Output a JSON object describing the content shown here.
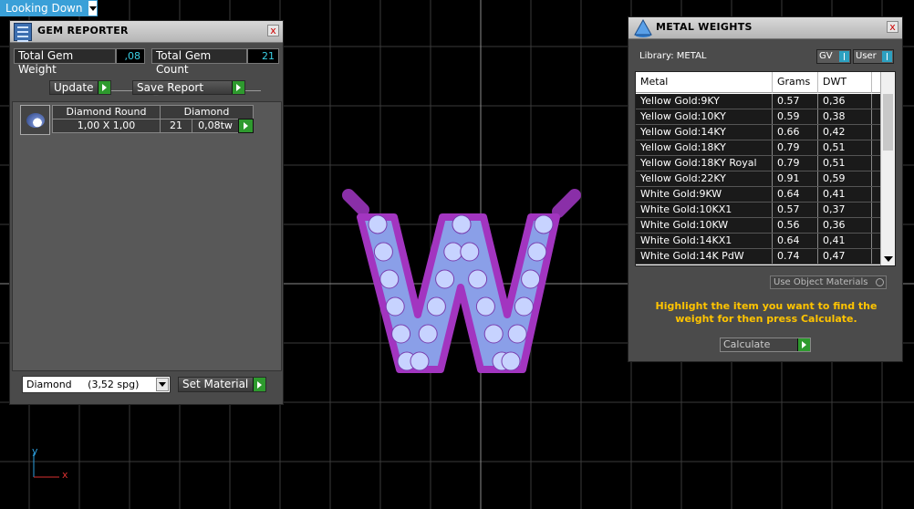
{
  "viewport": {
    "view_label": "Looking Down",
    "grid_color": "#3a3a3a",
    "axis_y": "y",
    "axis_x": "x",
    "model_letter": "W"
  },
  "gem_reporter": {
    "title": "GEM REPORTER",
    "close": "x",
    "total_weight_label": "Total Gem Weight",
    "total_weight_value": ",08",
    "total_count_label": "Total Gem Count",
    "total_count_value": "21",
    "update_label": "Update",
    "save_report_label": "Save Report",
    "gem": {
      "cut": "Diamond Round",
      "material": "Diamond",
      "size": "1,00 X 1,00",
      "count": "21",
      "weight": "0,08tw"
    },
    "material_select": "Diamond     (3,52 spg)",
    "set_material_label": "Set Material"
  },
  "metal_weights": {
    "title": "METAL WEIGHTS",
    "close": "x",
    "library_label": "Library: METAL",
    "gv_label": "GV",
    "user_label": "User",
    "columns": [
      "Metal",
      "Grams",
      "DWT"
    ],
    "rows": [
      [
        "Yellow Gold:9KY",
        "0.57",
        "0,36"
      ],
      [
        "Yellow Gold:10KY",
        "0.59",
        "0,38"
      ],
      [
        "Yellow Gold:14KY",
        "0.66",
        "0,42"
      ],
      [
        "Yellow Gold:18KY",
        "0.79",
        "0,51"
      ],
      [
        "Yellow Gold:18KY Royal",
        "0.79",
        "0,51"
      ],
      [
        "Yellow Gold:22KY",
        "0.91",
        "0,59"
      ],
      [
        "White Gold:9KW",
        "0.64",
        "0,41"
      ],
      [
        "White Gold:10KX1",
        "0.57",
        "0,37"
      ],
      [
        "White Gold:10KW",
        "0.56",
        "0,36"
      ],
      [
        "White Gold:14KX1",
        "0.64",
        "0,41"
      ],
      [
        "White Gold:14K PdW",
        "0.74",
        "0,47"
      ]
    ],
    "use_object_materials": "Use Object Materials",
    "hint": "Highlight the item you want to find the weight for then press Calculate.",
    "calculate_label": "Calculate"
  }
}
